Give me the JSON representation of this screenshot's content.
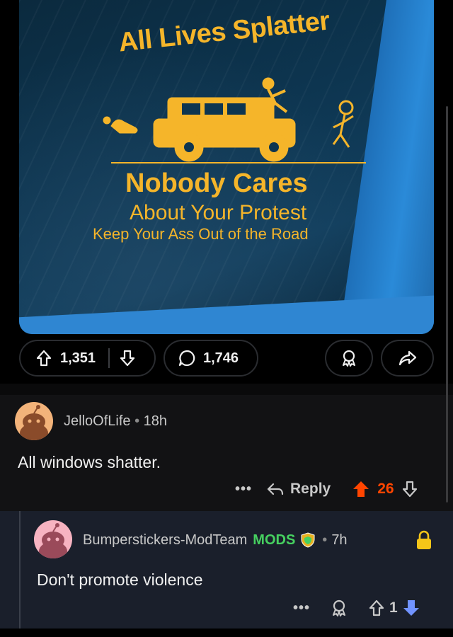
{
  "post_image": {
    "sticker_title": "All Lives Splatter",
    "sticker_line1": "Nobody Cares",
    "sticker_line2": "About Your Protest",
    "sticker_line3": "Keep Your Ass Out of the Road"
  },
  "post_actions": {
    "upvotes": "1,351",
    "comments": "1,746"
  },
  "comments": [
    {
      "username": "JelloOfLife",
      "time": "18h",
      "body": "All windows shatter.",
      "more": "•••",
      "reply_label": "Reply",
      "vote_count": "26",
      "upvoted": true
    },
    {
      "username": "Bumperstickers-ModTeam",
      "flair": "MODS",
      "time": "7h",
      "body": "Don't promote violence",
      "more": "•••",
      "vote_count": "1",
      "locked": true
    }
  ],
  "colors": {
    "upvote_active": "#ff4500",
    "downvote_active": "#7193ff",
    "mods_green": "#46d160",
    "lock_yellow": "#f5c518",
    "sticker_yellow": "#f5b52a"
  },
  "separator_dot": "•"
}
